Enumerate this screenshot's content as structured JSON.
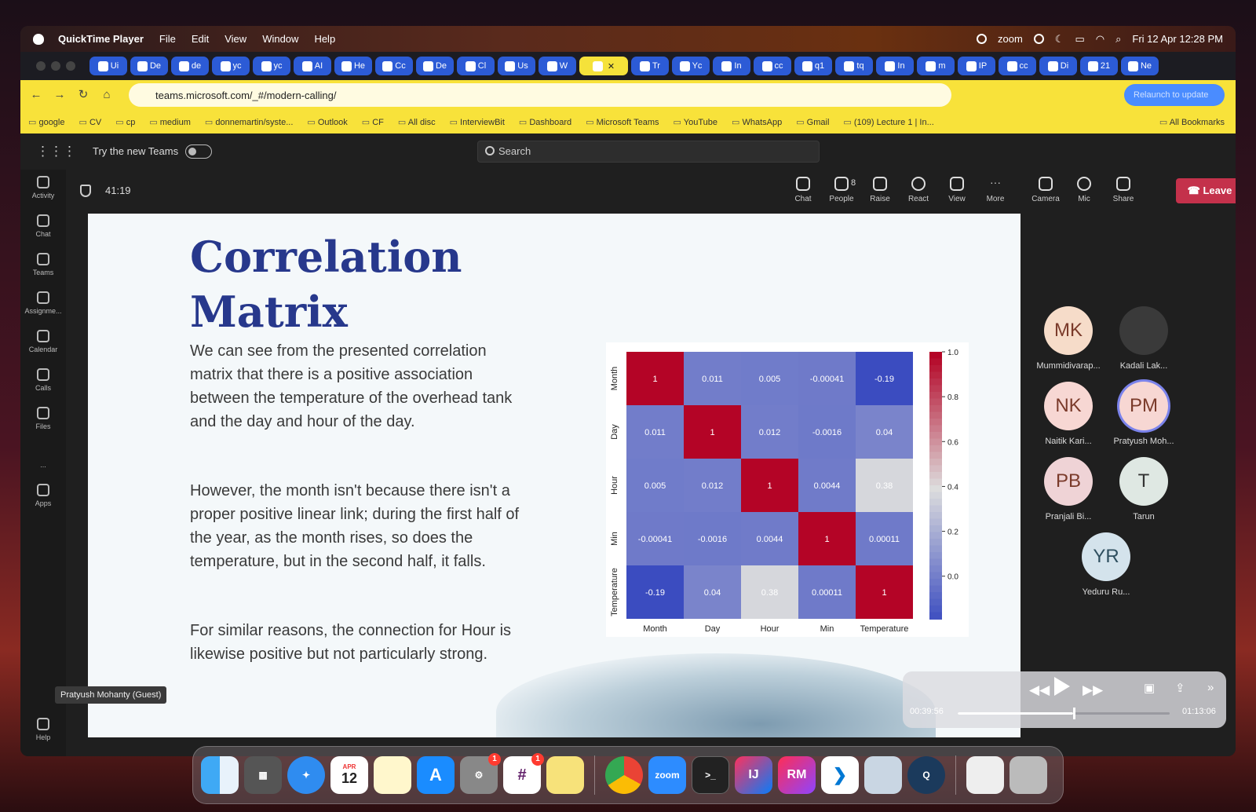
{
  "menubar": {
    "app_name": "QuickTime Player",
    "menus": [
      "File",
      "Edit",
      "View",
      "Window",
      "Help"
    ],
    "status": {
      "zoom": "zoom",
      "datetime": "Fri 12 Apr  12:28 PM"
    }
  },
  "tabs": [
    "Ui",
    "De",
    "de",
    "yc",
    "yc",
    "AI",
    "He",
    "Cc",
    "De",
    "Cl",
    "Us",
    "W",
    "",
    "Tr",
    "Yc",
    "In",
    "cc",
    "q1",
    "tq",
    "In",
    "m",
    "IP",
    "cc",
    "Di",
    "21",
    "Ne"
  ],
  "browser": {
    "url": "teams.microsoft.com/_#/modern-calling/",
    "relaunch": "Relaunch to update"
  },
  "bookmarks": [
    "google",
    "CV",
    "cp",
    "medium",
    "donnemartin/syste...",
    "Outlook",
    "CF",
    "All disc",
    "InterviewBit",
    "Dashboard",
    "Microsoft Teams",
    "YouTube",
    "WhatsApp",
    "Gmail",
    "(109) Lecture 1 | In...",
    "All Bookmarks"
  ],
  "teams": {
    "try_new": "Try the new Teams",
    "search_placeholder": "Search"
  },
  "rail": [
    "Activity",
    "Chat",
    "Teams",
    "Assignme...",
    "Calendar",
    "Calls",
    "Files",
    "...",
    "Apps",
    "Help"
  ],
  "meeting": {
    "timer": "41:19",
    "controls": {
      "chat": "Chat",
      "people": "People",
      "people_count": "8",
      "raise": "Raise",
      "react": "React",
      "view": "View",
      "more": "More",
      "camera": "Camera",
      "mic": "Mic",
      "share": "Share"
    },
    "leave": "Leave"
  },
  "slide": {
    "title_line1": "Correlation",
    "title_line2": "Matrix",
    "p1": "We can see from the presented correlation matrix that there is a positive association between the temperature of the overhead tank and the day and hour of the day.",
    "p2": "However, the month isn't because there isn't a proper positive linear link; during the first half of the year, as the month rises, so does the temperature, but in the second half, it falls.",
    "p3": "For similar reasons, the connection for Hour is likewise positive but not particularly strong."
  },
  "chart_data": {
    "type": "heatmap",
    "x": [
      "Month",
      "Day",
      "Hour",
      "Min",
      "Temperature"
    ],
    "y": [
      "Month",
      "Day",
      "Hour",
      "Min",
      "Temperature"
    ],
    "z": [
      [
        1,
        0.011,
        0.005,
        -0.00041,
        -0.19
      ],
      [
        0.011,
        1,
        0.012,
        -0.0016,
        0.04
      ],
      [
        0.005,
        0.012,
        1,
        0.0044,
        0.38
      ],
      [
        -0.00041,
        -0.0016,
        0.0044,
        1,
        0.00011
      ],
      [
        -0.19,
        0.04,
        0.38,
        0.00011,
        1
      ]
    ],
    "labels": [
      [
        "1",
        "0.011",
        "0.005",
        "-0.00041",
        "-0.19"
      ],
      [
        "0.011",
        "1",
        "0.012",
        "-0.0016",
        "0.04"
      ],
      [
        "0.005",
        "0.012",
        "1",
        "0.0044",
        "0.38"
      ],
      [
        "-0.00041",
        "-0.0016",
        "0.0044",
        "1",
        "0.00011"
      ],
      [
        "-0.19",
        "0.04",
        "0.38",
        "0.00011",
        "1"
      ]
    ],
    "colorbar": {
      "min": -0.19,
      "max": 1.0,
      "ticks": [
        "1.0",
        "0.8",
        "0.6",
        "0.4",
        "0.2",
        "0.0"
      ]
    },
    "colorscale": "coolwarm"
  },
  "participants": [
    {
      "initials": "MK",
      "name": "Mummidivarap..."
    },
    {
      "initials": "",
      "name": "Kadali Lak..."
    },
    {
      "initials": "NK",
      "name": "Naitik Kari..."
    },
    {
      "initials": "PM",
      "name": "Pratyush Moh..."
    },
    {
      "initials": "PB",
      "name": "Pranjali Bi..."
    },
    {
      "initials": "T",
      "name": "Tarun"
    },
    {
      "initials": "YR",
      "name": "Yeduru Ru..."
    }
  ],
  "presenter_label": "Pratyush Mohanty (Guest)",
  "player": {
    "current": "00:39:56",
    "total": "01:13:06",
    "progress": 0.546
  },
  "dock": {
    "calendar_month": "APR",
    "calendar_day": "12",
    "zoom": "zoom",
    "intellij": "IJ",
    "rubymine": "RM",
    "badges": [
      "1",
      "1"
    ]
  }
}
